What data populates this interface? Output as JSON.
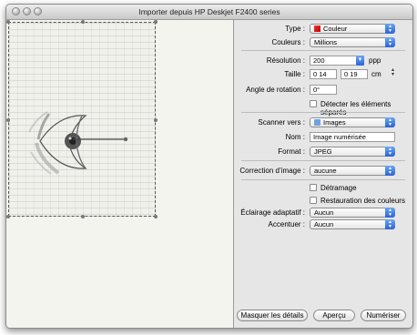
{
  "window": {
    "title": "Importer depuis HP Deskjet F2400 series"
  },
  "settings": {
    "type": {
      "label": "Type :",
      "value": "Couleur",
      "icon": "color-swatch-icon"
    },
    "colors": {
      "label": "Couleurs :",
      "value": "Millions"
    },
    "resolution": {
      "label": "Résolution :",
      "value": "200",
      "unit": "ppp"
    },
    "size": {
      "label": "Taille :",
      "width": "0 14",
      "height": "0 19",
      "unit": "cm"
    },
    "rotation": {
      "label": "Angle de rotation :",
      "value": "0°"
    },
    "detect_separate": {
      "label": "Détecter les éléments séparés",
      "checked": false
    },
    "scan_to": {
      "label": "Scanner vers :",
      "value": "Images",
      "icon": "folder-icon"
    },
    "name": {
      "label": "Nom :",
      "value": "Image numérisée"
    },
    "format": {
      "label": "Format :",
      "value": "JPEG"
    },
    "image_correction": {
      "label": "Correction d’image :",
      "value": "aucune"
    },
    "descreen": {
      "label": "Détramage",
      "checked": false
    },
    "color_restore": {
      "label": "Restauration des couleurs",
      "checked": false
    },
    "adaptive_light": {
      "label": "Éclairage adaptatif :",
      "value": "Aucun"
    },
    "sharpen": {
      "label": "Accentuer :",
      "value": "Aucun"
    }
  },
  "buttons": {
    "hide_details": "Masquer les détails",
    "preview": "Aperçu",
    "scan": "Numériser"
  },
  "colors": {
    "accent": "#2a63d6",
    "window_bg": "#e6e6e6"
  }
}
